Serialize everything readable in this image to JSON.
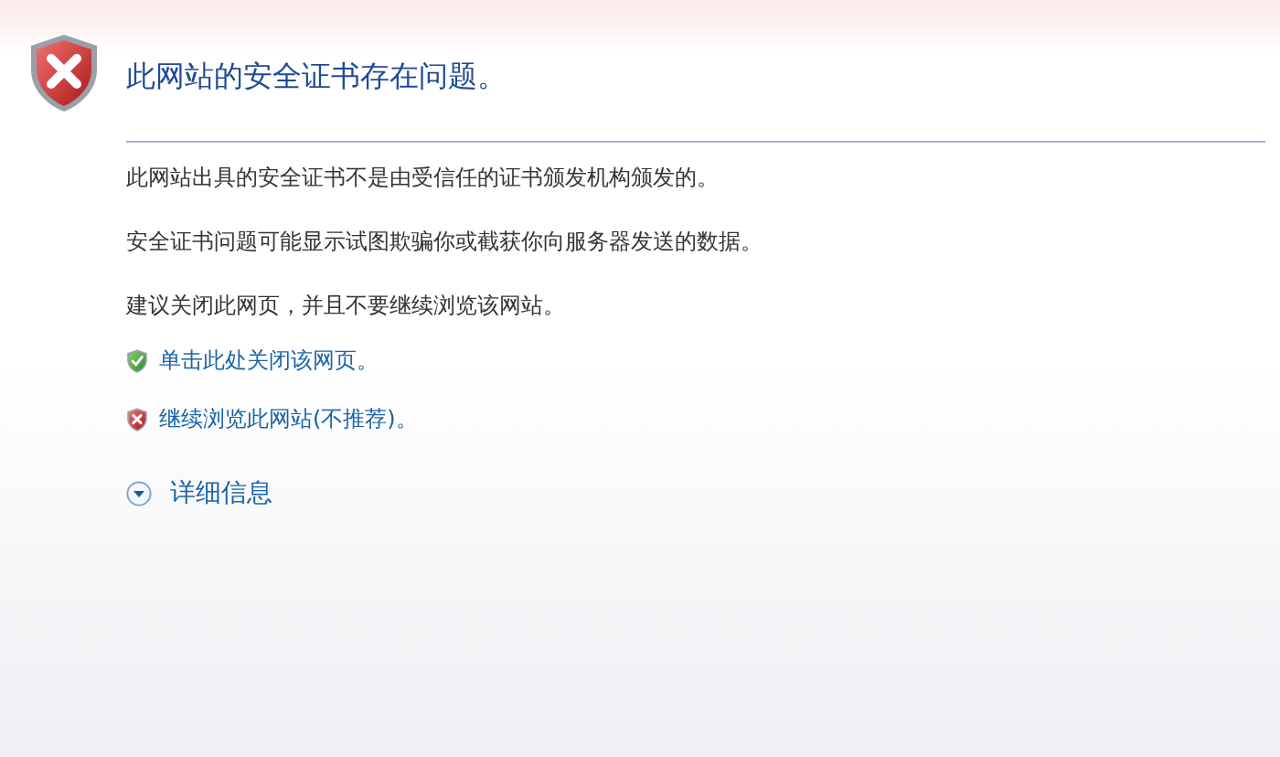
{
  "title": "此网站的安全证书存在问题。",
  "paragraphs": [
    "此网站出具的安全证书不是由受信任的证书颁发机构颁发的。",
    "安全证书问题可能显示试图欺骗你或截获你向服务器发送的数据。",
    "建议关闭此网页，并且不要继续浏览该网站。"
  ],
  "links": [
    {
      "kind": "safe",
      "label": "单击此处关闭该网页。"
    },
    {
      "kind": "unsafe",
      "label": "继续浏览此网站(不推荐)。"
    }
  ],
  "details": {
    "label": "详细信息"
  }
}
